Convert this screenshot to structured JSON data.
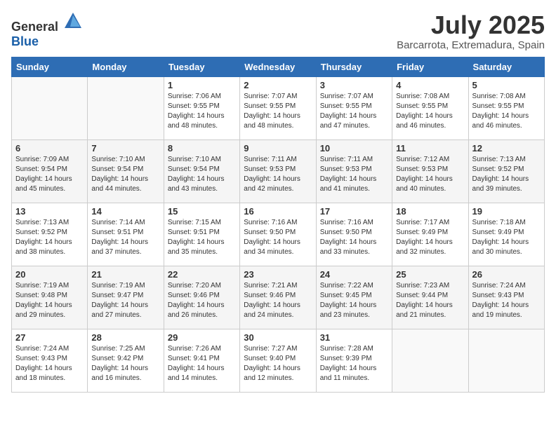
{
  "header": {
    "logo_general": "General",
    "logo_blue": "Blue",
    "month_title": "July 2025",
    "location": "Barcarrota, Extremadura, Spain"
  },
  "days_of_week": [
    "Sunday",
    "Monday",
    "Tuesday",
    "Wednesday",
    "Thursday",
    "Friday",
    "Saturday"
  ],
  "weeks": [
    [
      {
        "day": "",
        "sunrise": "",
        "sunset": "",
        "daylight": ""
      },
      {
        "day": "",
        "sunrise": "",
        "sunset": "",
        "daylight": ""
      },
      {
        "day": "1",
        "sunrise": "Sunrise: 7:06 AM",
        "sunset": "Sunset: 9:55 PM",
        "daylight": "Daylight: 14 hours and 48 minutes."
      },
      {
        "day": "2",
        "sunrise": "Sunrise: 7:07 AM",
        "sunset": "Sunset: 9:55 PM",
        "daylight": "Daylight: 14 hours and 48 minutes."
      },
      {
        "day": "3",
        "sunrise": "Sunrise: 7:07 AM",
        "sunset": "Sunset: 9:55 PM",
        "daylight": "Daylight: 14 hours and 47 minutes."
      },
      {
        "day": "4",
        "sunrise": "Sunrise: 7:08 AM",
        "sunset": "Sunset: 9:55 PM",
        "daylight": "Daylight: 14 hours and 46 minutes."
      },
      {
        "day": "5",
        "sunrise": "Sunrise: 7:08 AM",
        "sunset": "Sunset: 9:55 PM",
        "daylight": "Daylight: 14 hours and 46 minutes."
      }
    ],
    [
      {
        "day": "6",
        "sunrise": "Sunrise: 7:09 AM",
        "sunset": "Sunset: 9:54 PM",
        "daylight": "Daylight: 14 hours and 45 minutes."
      },
      {
        "day": "7",
        "sunrise": "Sunrise: 7:10 AM",
        "sunset": "Sunset: 9:54 PM",
        "daylight": "Daylight: 14 hours and 44 minutes."
      },
      {
        "day": "8",
        "sunrise": "Sunrise: 7:10 AM",
        "sunset": "Sunset: 9:54 PM",
        "daylight": "Daylight: 14 hours and 43 minutes."
      },
      {
        "day": "9",
        "sunrise": "Sunrise: 7:11 AM",
        "sunset": "Sunset: 9:53 PM",
        "daylight": "Daylight: 14 hours and 42 minutes."
      },
      {
        "day": "10",
        "sunrise": "Sunrise: 7:11 AM",
        "sunset": "Sunset: 9:53 PM",
        "daylight": "Daylight: 14 hours and 41 minutes."
      },
      {
        "day": "11",
        "sunrise": "Sunrise: 7:12 AM",
        "sunset": "Sunset: 9:53 PM",
        "daylight": "Daylight: 14 hours and 40 minutes."
      },
      {
        "day": "12",
        "sunrise": "Sunrise: 7:13 AM",
        "sunset": "Sunset: 9:52 PM",
        "daylight": "Daylight: 14 hours and 39 minutes."
      }
    ],
    [
      {
        "day": "13",
        "sunrise": "Sunrise: 7:13 AM",
        "sunset": "Sunset: 9:52 PM",
        "daylight": "Daylight: 14 hours and 38 minutes."
      },
      {
        "day": "14",
        "sunrise": "Sunrise: 7:14 AM",
        "sunset": "Sunset: 9:51 PM",
        "daylight": "Daylight: 14 hours and 37 minutes."
      },
      {
        "day": "15",
        "sunrise": "Sunrise: 7:15 AM",
        "sunset": "Sunset: 9:51 PM",
        "daylight": "Daylight: 14 hours and 35 minutes."
      },
      {
        "day": "16",
        "sunrise": "Sunrise: 7:16 AM",
        "sunset": "Sunset: 9:50 PM",
        "daylight": "Daylight: 14 hours and 34 minutes."
      },
      {
        "day": "17",
        "sunrise": "Sunrise: 7:16 AM",
        "sunset": "Sunset: 9:50 PM",
        "daylight": "Daylight: 14 hours and 33 minutes."
      },
      {
        "day": "18",
        "sunrise": "Sunrise: 7:17 AM",
        "sunset": "Sunset: 9:49 PM",
        "daylight": "Daylight: 14 hours and 32 minutes."
      },
      {
        "day": "19",
        "sunrise": "Sunrise: 7:18 AM",
        "sunset": "Sunset: 9:49 PM",
        "daylight": "Daylight: 14 hours and 30 minutes."
      }
    ],
    [
      {
        "day": "20",
        "sunrise": "Sunrise: 7:19 AM",
        "sunset": "Sunset: 9:48 PM",
        "daylight": "Daylight: 14 hours and 29 minutes."
      },
      {
        "day": "21",
        "sunrise": "Sunrise: 7:19 AM",
        "sunset": "Sunset: 9:47 PM",
        "daylight": "Daylight: 14 hours and 27 minutes."
      },
      {
        "day": "22",
        "sunrise": "Sunrise: 7:20 AM",
        "sunset": "Sunset: 9:46 PM",
        "daylight": "Daylight: 14 hours and 26 minutes."
      },
      {
        "day": "23",
        "sunrise": "Sunrise: 7:21 AM",
        "sunset": "Sunset: 9:46 PM",
        "daylight": "Daylight: 14 hours and 24 minutes."
      },
      {
        "day": "24",
        "sunrise": "Sunrise: 7:22 AM",
        "sunset": "Sunset: 9:45 PM",
        "daylight": "Daylight: 14 hours and 23 minutes."
      },
      {
        "day": "25",
        "sunrise": "Sunrise: 7:23 AM",
        "sunset": "Sunset: 9:44 PM",
        "daylight": "Daylight: 14 hours and 21 minutes."
      },
      {
        "day": "26",
        "sunrise": "Sunrise: 7:24 AM",
        "sunset": "Sunset: 9:43 PM",
        "daylight": "Daylight: 14 hours and 19 minutes."
      }
    ],
    [
      {
        "day": "27",
        "sunrise": "Sunrise: 7:24 AM",
        "sunset": "Sunset: 9:43 PM",
        "daylight": "Daylight: 14 hours and 18 minutes."
      },
      {
        "day": "28",
        "sunrise": "Sunrise: 7:25 AM",
        "sunset": "Sunset: 9:42 PM",
        "daylight": "Daylight: 14 hours and 16 minutes."
      },
      {
        "day": "29",
        "sunrise": "Sunrise: 7:26 AM",
        "sunset": "Sunset: 9:41 PM",
        "daylight": "Daylight: 14 hours and 14 minutes."
      },
      {
        "day": "30",
        "sunrise": "Sunrise: 7:27 AM",
        "sunset": "Sunset: 9:40 PM",
        "daylight": "Daylight: 14 hours and 12 minutes."
      },
      {
        "day": "31",
        "sunrise": "Sunrise: 7:28 AM",
        "sunset": "Sunset: 9:39 PM",
        "daylight": "Daylight: 14 hours and 11 minutes."
      },
      {
        "day": "",
        "sunrise": "",
        "sunset": "",
        "daylight": ""
      },
      {
        "day": "",
        "sunrise": "",
        "sunset": "",
        "daylight": ""
      }
    ]
  ]
}
